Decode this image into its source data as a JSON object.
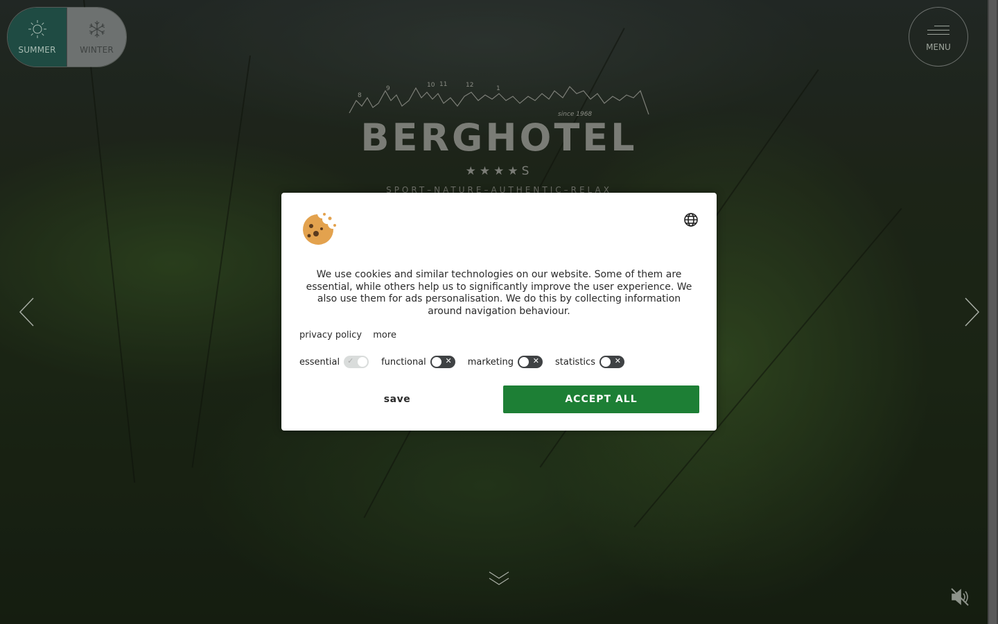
{
  "season_toggle": {
    "summer_label": "SUMMER",
    "winter_label": "WINTER",
    "active": "summer"
  },
  "menu": {
    "label": "MENU"
  },
  "logo": {
    "peak_numbers": [
      "8",
      "9",
      "10",
      "11",
      "12",
      "1"
    ],
    "since": "since 1968",
    "name": "BERGHOTEL",
    "stars": "★★★★S",
    "tagline": "SPORT–NATURE–AUTHENTIC–RELAX"
  },
  "cookie_dialog": {
    "text": "We use cookies and similar technologies on our website. Some of them are essential, while others help us to significantly improve the user experience. We also use them for ads personalisation. We do this by collecting information around navigation behaviour.",
    "privacy_link": "privacy policy",
    "more_link": "more",
    "toggles": [
      {
        "label": "essential",
        "state": "on",
        "disabled": true
      },
      {
        "label": "functional",
        "state": "off"
      },
      {
        "label": "marketing",
        "state": "off"
      },
      {
        "label": "statistics",
        "state": "off"
      }
    ],
    "save_label": "save",
    "accept_label": "ACCEPT ALL",
    "accept_color": "#1d7f35"
  },
  "icons": {
    "summer": "sun-icon",
    "winter": "snowflake-icon",
    "cookie": "cookie-icon",
    "language": "globe-icon",
    "prev": "chevron-left-icon",
    "next": "chevron-right-icon",
    "scroll": "double-chevron-down-icon",
    "mute": "speaker-muted-icon"
  }
}
